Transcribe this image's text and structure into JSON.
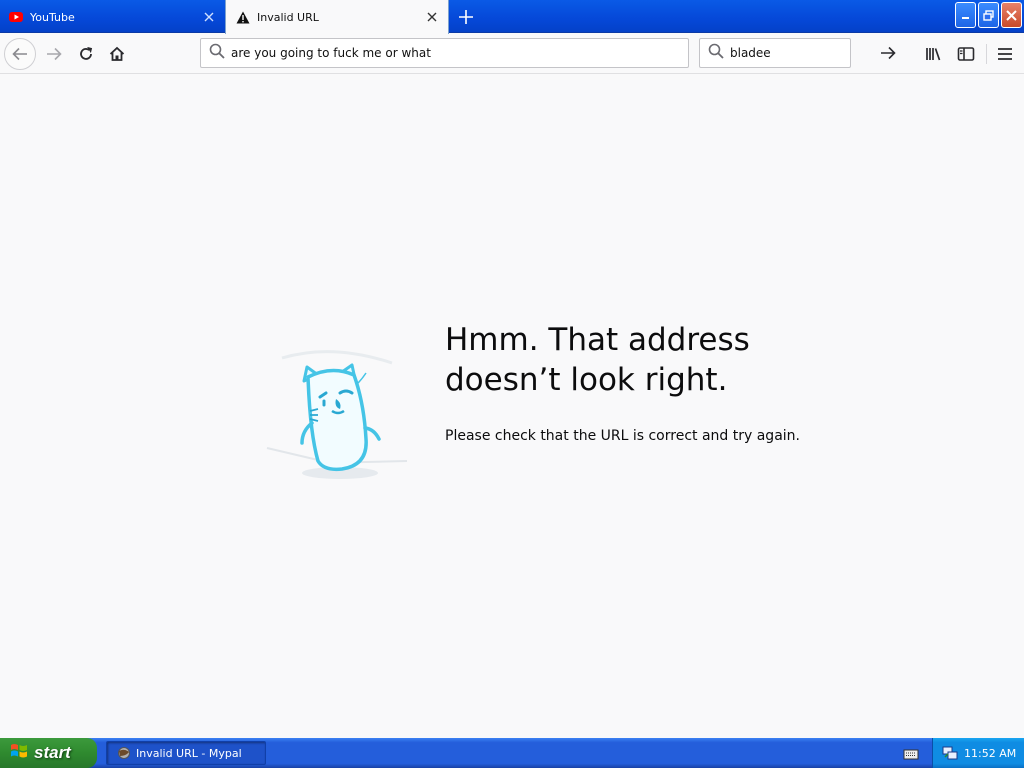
{
  "tabs": [
    {
      "label": "YouTube",
      "icon": "youtube-icon"
    },
    {
      "label": "Invalid URL",
      "icon": "warning-icon"
    }
  ],
  "navbar": {
    "url": "are you going to fuck me or what",
    "search_value": "bladee"
  },
  "error_page": {
    "title": "Hmm. That address doesn’t look right.",
    "description": "Please check that the URL is correct and try again."
  },
  "taskbar": {
    "start_label": "start",
    "task_label": "Invalid URL - Mypal",
    "clock": "11:52 AM"
  },
  "colors": {
    "accent": "#0a5ae6",
    "illustration": "#45c4e6",
    "start_green": "#2f8a2f"
  }
}
